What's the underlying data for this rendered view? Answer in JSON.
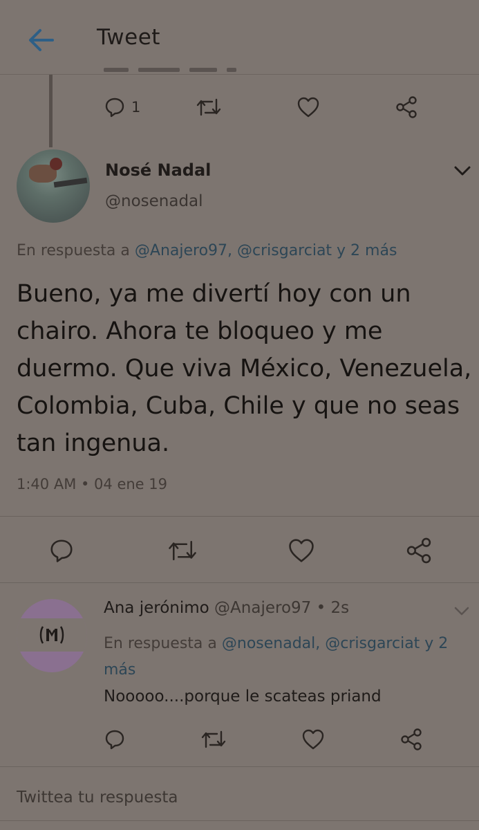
{
  "header": {
    "title": "Tweet"
  },
  "parent_tweet": {
    "reply_count": "1"
  },
  "main_tweet": {
    "display_name": "Nosé Nadal",
    "handle": "@nosenadal",
    "reply_prefix": "En respuesta a",
    "reply_mentions": "@Anajero97, @crisgarciat y 2 más",
    "text": "Bueno, ya me divertí hoy con un chairo. Ahora te bloqueo y me duermo. Que viva México, Venezuela, Colombia, Cuba, Chile y que no seas tan ingenua.",
    "timestamp": "1:40 AM • 04 ene 19"
  },
  "reply_tweet": {
    "display_name": "Ana jerónimo",
    "handle": "@Anajero97",
    "time": "• 2s",
    "reply_prefix": "En respuesta a",
    "reply_mentions": "@nosenadal, @crisgarciat y 2 más",
    "text": "Nooooo....porque le scateas priand"
  },
  "compose": {
    "placeholder": "Twittea tu respuesta"
  },
  "icons": [
    "back-arrow-icon",
    "reply-icon",
    "retweet-icon",
    "like-icon",
    "share-icon",
    "chevron-down-icon"
  ],
  "colors": {
    "accent": "#2d5f86",
    "background": "#7d7570"
  }
}
